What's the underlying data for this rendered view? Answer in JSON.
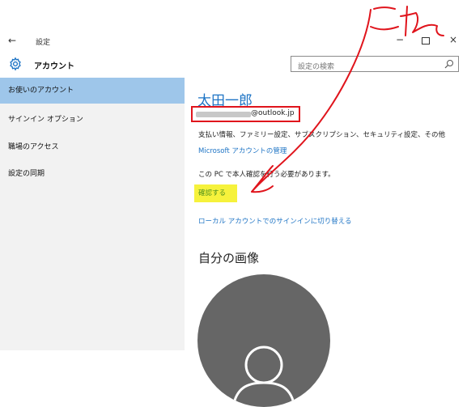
{
  "window": {
    "back_glyph": "←",
    "title": "設定",
    "minimize_glyph": "−",
    "close_glyph": "×"
  },
  "header": {
    "title": "アカウント",
    "search_placeholder": "設定の検索"
  },
  "sidebar": {
    "items": [
      {
        "label": "お使いのアカウント",
        "active": true
      },
      {
        "label": "サインイン オプション",
        "active": false
      },
      {
        "label": "職場のアクセス",
        "active": false
      },
      {
        "label": "設定の同期",
        "active": false
      }
    ]
  },
  "account": {
    "name": "太田一郎",
    "email_suffix": "@outlook.jp",
    "description": "支払い情報、ファミリー設定、サブスクリプション、セキュリティ設定、その他",
    "manage_link": "Microsoft アカウントの管理",
    "verify_message": "この PC で本人確認を行う必要があります。",
    "verify_button": "確認する",
    "local_switch_link": "ローカル アカウントでのサインインに切り替える"
  },
  "picture": {
    "title": "自分の画像"
  },
  "annotation": {
    "handwritten_text": "これ",
    "color": "#e0141c"
  },
  "colors": {
    "accent": "#1e74c5",
    "sidebar_active": "#9ec6ea",
    "highlight": "#f6f23c",
    "highlight_text": "#4b8f1c"
  }
}
